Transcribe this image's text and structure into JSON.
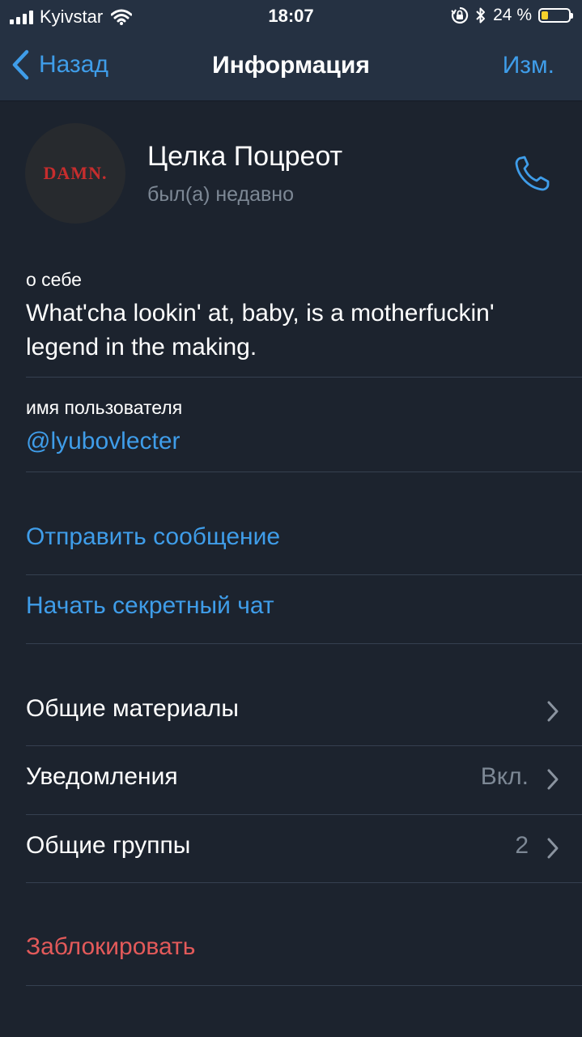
{
  "status_bar": {
    "carrier": "Kyivstar",
    "time": "18:07",
    "battery_text": "24 %",
    "battery_level": 0.24,
    "icons": [
      "signal-icon",
      "wifi-icon",
      "orientation-lock-icon",
      "bluetooth-icon",
      "battery-icon"
    ]
  },
  "nav": {
    "back_label": "Назад",
    "title": "Информация",
    "edit_label": "Изм."
  },
  "profile": {
    "avatar_text": "DAMN.",
    "name": "Целка Поцреот",
    "status": "был(а) недавно"
  },
  "about": {
    "label": "о себе",
    "text": "What'cha lookin' at, baby, is a motherfuckin' legend in the making."
  },
  "username": {
    "label": "имя пользователя",
    "value": "@lyubovlecter"
  },
  "actions": {
    "send_message": "Отправить сообщение",
    "secret_chat": "Начать секретный чат"
  },
  "settings": {
    "shared_media": "Общие материалы",
    "notifications": "Уведомления",
    "notifications_value": "Вкл.",
    "common_groups": "Общие группы",
    "common_groups_value": "2"
  },
  "block": {
    "label": "Заблокировать"
  },
  "colors": {
    "background": "#1c232e",
    "bar": "#253142",
    "accent": "#3f9de9",
    "destructive": "#e35a5a",
    "secondary_text": "#7d8895"
  }
}
